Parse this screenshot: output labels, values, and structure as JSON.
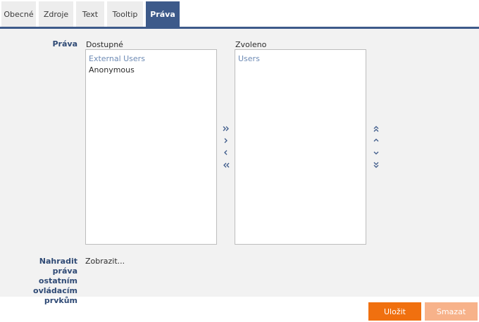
{
  "tabs": [
    {
      "label": "Obecné"
    },
    {
      "label": "Zdroje"
    },
    {
      "label": "Text"
    },
    {
      "label": "Tooltip"
    },
    {
      "label": "Práva",
      "active": true
    }
  ],
  "rights": {
    "label": "Práva",
    "available": {
      "heading": "Dostupné",
      "items": [
        "External Users",
        "Anonymous"
      ]
    },
    "selected": {
      "heading": "Zvoleno",
      "items": [
        "Users"
      ]
    },
    "move_buttons": [
      "chevron-double-right-icon",
      "chevron-right-icon",
      "chevron-left-icon",
      "chevron-double-left-icon"
    ],
    "order_buttons": [
      "chevron-double-up-icon",
      "chevron-up-icon",
      "chevron-down-icon",
      "chevron-double-down-icon"
    ]
  },
  "replace": {
    "label_lines": [
      "Nahradit práva",
      "ostatním",
      "ovládacím",
      "prvkům"
    ],
    "link": "Zobrazit..."
  },
  "actions": {
    "save": "Uložit",
    "delete": "Smazat"
  },
  "colors": {
    "accent": "#3d5a8a",
    "primary_button": "#f0700f",
    "secondary_button": "#f7b28a"
  }
}
